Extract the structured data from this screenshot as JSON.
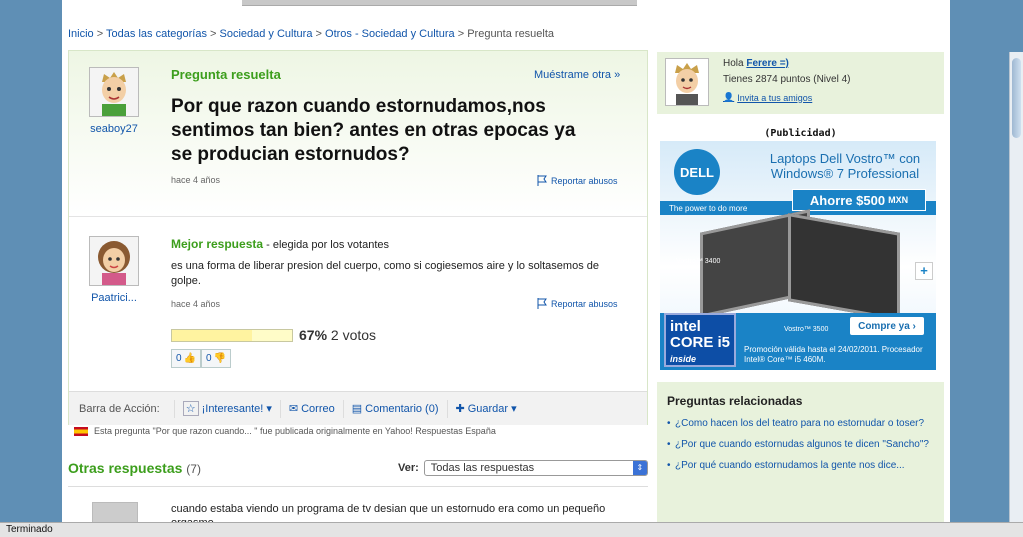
{
  "breadcrumb": {
    "items": [
      "Inicio",
      "Todas las categorías",
      "Sociedad y Cultura",
      "Otros - Sociedad y Cultura"
    ],
    "current": "Pregunta resuelta",
    "separator": ">"
  },
  "question": {
    "status": "Pregunta resuelta",
    "show_other": "Muéstrame otra »",
    "asker": "seaboy27",
    "title": "Por que razon cuando estornudamos,nos sentimos tan bien? antes en otras epocas ya se producian estornudos?",
    "time": "hace 4 años",
    "report": "Reportar abusos"
  },
  "best_answer": {
    "label": "Mejor respuesta",
    "chosen_by": " - elegida por los votantes",
    "user": "Paatrici...",
    "text": "es una forma de liberar presion del cuerpo, como si cogiesemos aire y lo soltasemos de golpe.",
    "time": "hace 4 años",
    "report": "Reportar abusos",
    "vote_percent": "67%",
    "vote_fraction": 0.67,
    "votes": "2 votos",
    "thumbs_up": "0",
    "thumbs_down": "0"
  },
  "action_bar": {
    "label": "Barra de Acción:",
    "interesting": "¡Interesante!",
    "mail": "Correo",
    "comment": "Comentario (0)",
    "save": "Guardar"
  },
  "origin_note": "Esta pregunta \"Por que razon cuando... \" fue publicada originalmente en Yahoo! Respuestas España",
  "other_answers": {
    "heading": "Otras respuestas",
    "count": "(7)",
    "ver_label": "Ver:",
    "filter_value": "Todas las respuestas",
    "first_text": "cuando estaba viendo un programa de tv desian que un estornudo era como un pequeño orgasmo"
  },
  "user_panel": {
    "greeting": "Hola",
    "username": "Ferere =)",
    "points": "Tienes 2874 puntos (Nivel 4)",
    "invite": "Invita a tus amigos"
  },
  "ad": {
    "label": "(Publicidad)",
    "brand": "DELL",
    "tagline": "The power to do more",
    "title": "Laptops Dell Vostro™ con Windows® 7 Professional",
    "save_amount": "Ahorre $500",
    "save_currency": "MXN",
    "model1": "Vostro™ 3400",
    "model2": "Vostro™ 3500",
    "buy": "Compre ya ›",
    "intel_line1": "intel",
    "intel_line2": "CORE i5",
    "intel_line3": "inside",
    "promo": "Promoción válida hasta el 24/02/2011. Procesador Intel® Core™ i5 460M.",
    "plus": "+"
  },
  "related": {
    "heading": "Preguntas relacionadas",
    "items": [
      "¿Como hacen los del teatro para no estornudar o toser?",
      "¿Por que cuando estornudas algunos te dicen \"Sancho\"?",
      "¿Por qué cuando estornudamos la gente nos dice..."
    ]
  },
  "status_bar": "Terminado",
  "colors": {
    "accent_green": "#3c9e1c",
    "link_blue": "#1155aa",
    "desktop_blue": "#5f8fb5",
    "panel_green": "#e8f2dc"
  }
}
